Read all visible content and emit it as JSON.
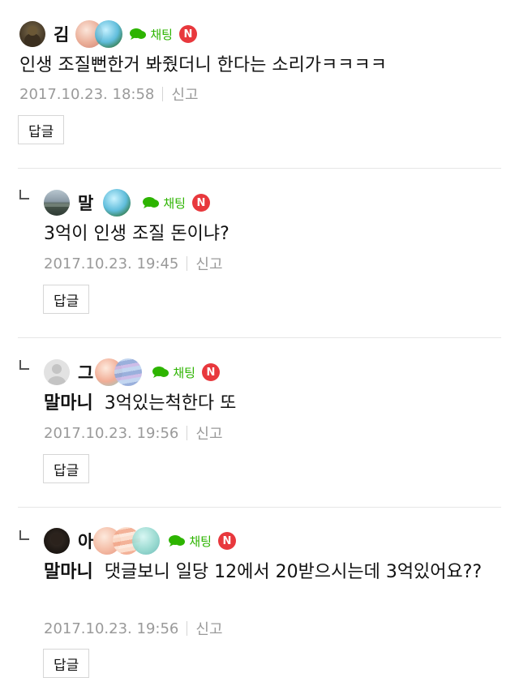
{
  "comments": [
    {
      "nickname": "김",
      "chat_label": "채팅",
      "badge": "N",
      "mention": "",
      "text": "인생 조질뻔한거 봐줬더니 한다는 소리가ㅋㅋㅋㅋ",
      "date": "2017.10.23. 18:58",
      "report": "신고",
      "reply_button": "답글"
    },
    {
      "nickname": "말",
      "chat_label": "채팅",
      "badge": "N",
      "mention": "",
      "text": "3억이 인생 조질 돈이냐?",
      "date": "2017.10.23. 19:45",
      "report": "신고",
      "reply_button": "답글"
    },
    {
      "nickname": "그",
      "chat_label": "채팅",
      "badge": "N",
      "mention": "말마니",
      "text": "3억있는척한다 또",
      "date": "2017.10.23. 19:56",
      "report": "신고",
      "reply_button": "답글"
    },
    {
      "nickname": "아",
      "chat_label": "채팅",
      "badge": "N",
      "mention": "말마니",
      "text": "댓글보니 일당 12에서 20받으시는데 3억있어요??",
      "date": "2017.10.23. 19:56",
      "report": "신고",
      "reply_button": "답글"
    }
  ]
}
